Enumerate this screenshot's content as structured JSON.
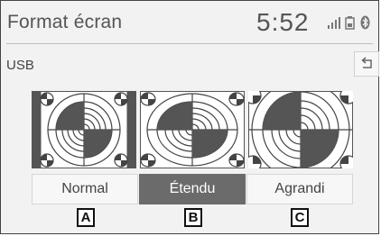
{
  "header": {
    "title": "Format écran",
    "clock": "5:52"
  },
  "status_icons": [
    "signal-icon",
    "battery-icon",
    "bluetooth-icon"
  ],
  "source_label": "USB",
  "back_icon": "back-arrow-icon",
  "options": [
    {
      "label": "Normal",
      "marker": "A",
      "selected": false
    },
    {
      "label": "Étendu",
      "marker": "B",
      "selected": true
    },
    {
      "label": "Agrandi",
      "marker": "C",
      "selected": false
    }
  ],
  "colors": {
    "selected_button": "#6b6b6b",
    "button": "#f7f7f7",
    "background": "#f2f2f2"
  }
}
